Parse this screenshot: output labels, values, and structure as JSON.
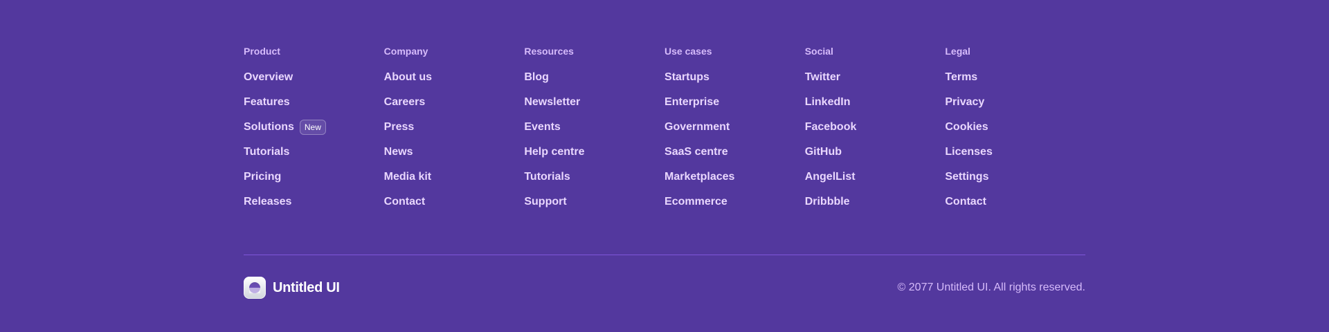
{
  "columns": [
    {
      "heading": "Product",
      "links": [
        {
          "label": "Overview"
        },
        {
          "label": "Features"
        },
        {
          "label": "Solutions",
          "badge": "New"
        },
        {
          "label": "Tutorials"
        },
        {
          "label": "Pricing"
        },
        {
          "label": "Releases"
        }
      ]
    },
    {
      "heading": "Company",
      "links": [
        {
          "label": "About us"
        },
        {
          "label": "Careers"
        },
        {
          "label": "Press"
        },
        {
          "label": "News"
        },
        {
          "label": "Media kit"
        },
        {
          "label": "Contact"
        }
      ]
    },
    {
      "heading": "Resources",
      "links": [
        {
          "label": "Blog"
        },
        {
          "label": "Newsletter"
        },
        {
          "label": "Events"
        },
        {
          "label": "Help centre"
        },
        {
          "label": "Tutorials"
        },
        {
          "label": "Support"
        }
      ]
    },
    {
      "heading": "Use cases",
      "links": [
        {
          "label": "Startups"
        },
        {
          "label": "Enterprise"
        },
        {
          "label": "Government"
        },
        {
          "label": "SaaS centre"
        },
        {
          "label": "Marketplaces"
        },
        {
          "label": "Ecommerce"
        }
      ]
    },
    {
      "heading": "Social",
      "links": [
        {
          "label": "Twitter"
        },
        {
          "label": "LinkedIn"
        },
        {
          "label": "Facebook"
        },
        {
          "label": "GitHub"
        },
        {
          "label": "AngelList"
        },
        {
          "label": "Dribbble"
        }
      ]
    },
    {
      "heading": "Legal",
      "links": [
        {
          "label": "Terms"
        },
        {
          "label": "Privacy"
        },
        {
          "label": "Cookies"
        },
        {
          "label": "Licenses"
        },
        {
          "label": "Settings"
        },
        {
          "label": "Contact"
        }
      ]
    }
  ],
  "brand": {
    "name": "Untitled UI",
    "icon": "logo-icon"
  },
  "copyright": "© 2077 Untitled UI. All rights reserved.",
  "colors": {
    "background": "#53389e",
    "heading": "#d6bbfb",
    "link": "#e9d7fe",
    "divider": "#7f56d9"
  }
}
